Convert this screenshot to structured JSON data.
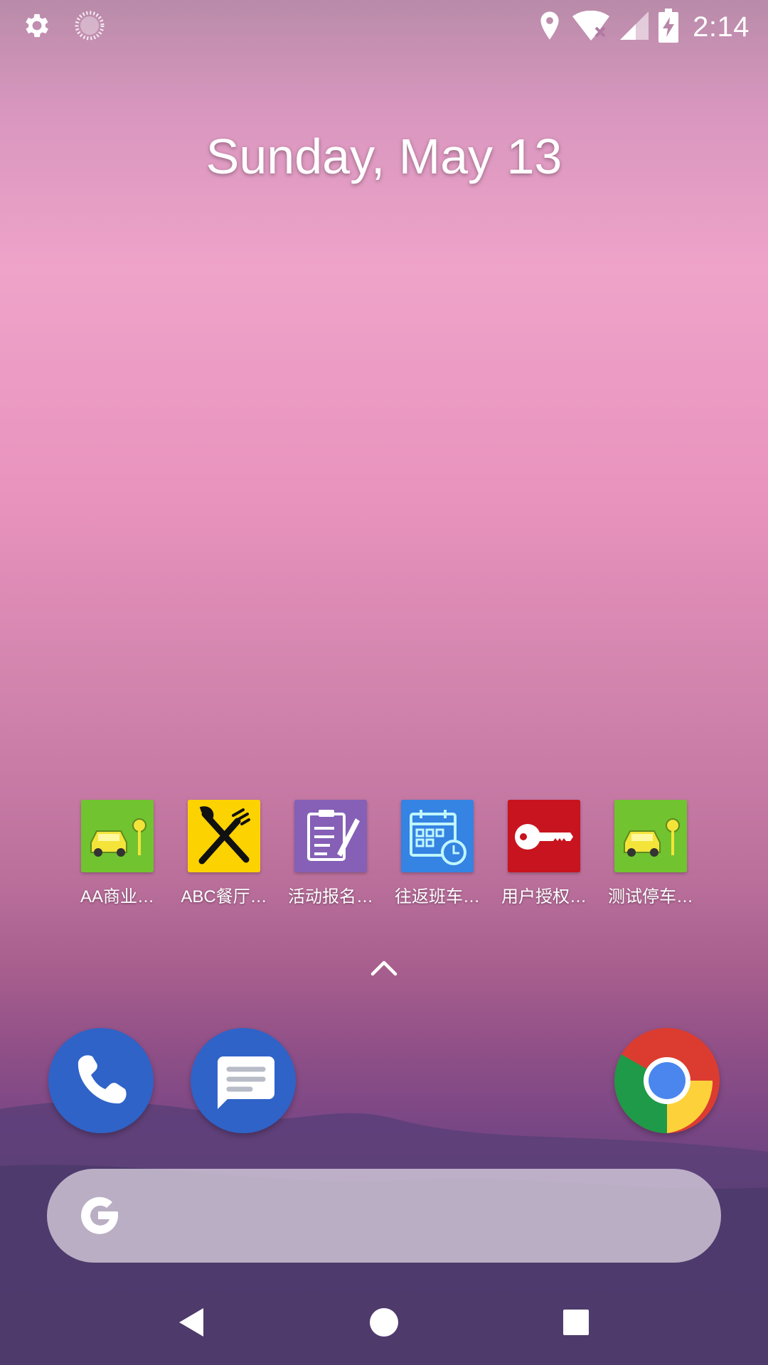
{
  "status_bar": {
    "left_icons": [
      "gear-icon",
      "sync-spinner-icon"
    ],
    "right_icons": [
      "location-pin-icon",
      "wifi-off-icon",
      "cell-signal-icon",
      "battery-charging-icon"
    ],
    "time": "2:14"
  },
  "date_widget": {
    "text": "Sunday, May 13"
  },
  "apps": [
    {
      "label": "AA商业…",
      "icon": "car-parking-icon",
      "color": "#6cbf2e"
    },
    {
      "label": "ABC餐厅…",
      "icon": "fork-knife-icon",
      "color": "#f5c400"
    },
    {
      "label": "活动报名…",
      "icon": "clipboard-pen-icon",
      "color": "#7e58b0"
    },
    {
      "label": "往返班车…",
      "icon": "calendar-clock-icon",
      "color": "#2f7fe0"
    },
    {
      "label": "用户授权…",
      "icon": "key-icon",
      "color": "#c4121c"
    },
    {
      "label": "测试停车…",
      "icon": "car-parking-icon",
      "color": "#6cbf2e"
    }
  ],
  "app_drawer": {
    "icon": "chevron-up-icon"
  },
  "dock": {
    "items": [
      "phone-icon",
      "messages-icon",
      "chrome-icon"
    ]
  },
  "search": {
    "icon": "google-g-icon",
    "placeholder": ""
  },
  "nav": {
    "items": [
      "back-icon",
      "home-icon",
      "recents-icon"
    ]
  }
}
